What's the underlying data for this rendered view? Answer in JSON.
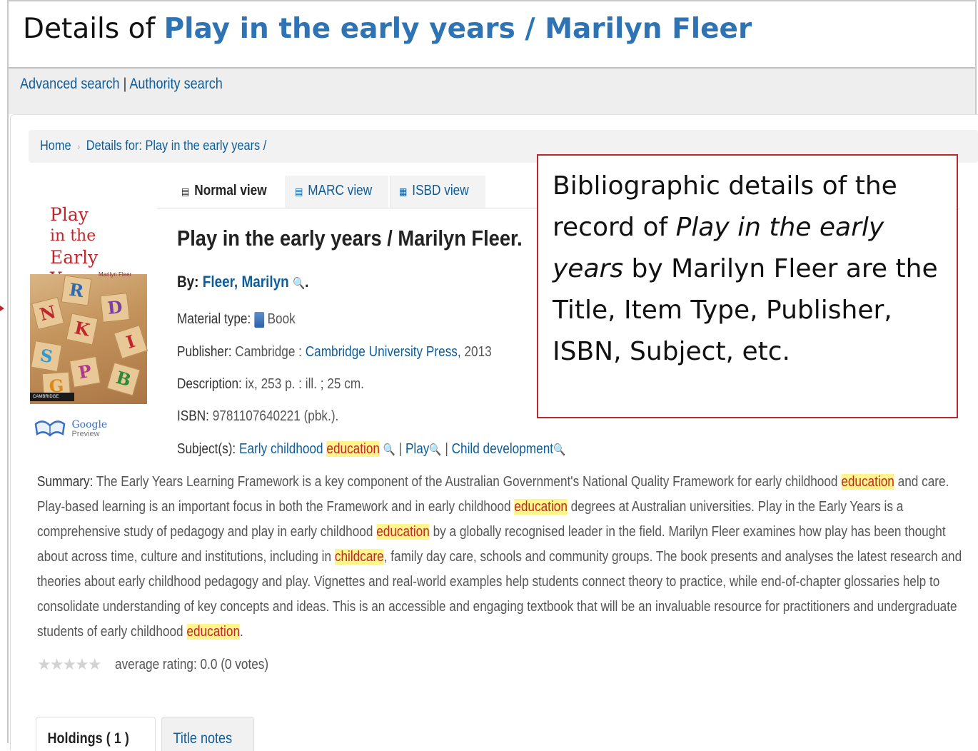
{
  "slide_title": {
    "prefix": "Details of ",
    "highlight": "Play in the early years / Marilyn Fleer"
  },
  "nav": {
    "advanced_search": "Advanced search",
    "separator": "|",
    "authority_search": "Authority search"
  },
  "breadcrumb": {
    "home": "Home",
    "current": "Details for: Play in the early years /"
  },
  "view_tabs": [
    {
      "label": "Normal view",
      "active": true
    },
    {
      "label": "MARC view",
      "active": false
    },
    {
      "label": "ISBD view",
      "active": false
    }
  ],
  "cover": {
    "title_line1": "Play",
    "title_line2": "in the",
    "title_line3": "Early Years",
    "author": "Marilyn Fleer",
    "publisher_band": "CAMBRIDGE",
    "blocks": [
      "N",
      "R",
      "D",
      "K",
      "I",
      "S",
      "P",
      "B",
      "G"
    ]
  },
  "google_preview": {
    "line1": "Google",
    "line2": "Preview"
  },
  "record": {
    "title": "Play in the early years / Marilyn Fleer.",
    "by_label": "By:",
    "author": "Fleer, Marilyn",
    "by_suffix": ".",
    "material_label": "Material type:",
    "material_value": "Book",
    "publisher_label": "Publisher:",
    "publisher_place": "Cambridge :",
    "publisher_name": "Cambridge University Press,",
    "publisher_year": "2013",
    "description_label": "Description:",
    "description_value": "ix, 253 p. : ill. ; 25 cm.",
    "isbn_label": "ISBN:",
    "isbn_value": "9781107640221 (pbk.).",
    "subjects_label": "Subject(s):",
    "subject1_a": "Early childhood",
    "subject1_b": "education",
    "subject_sep": "|",
    "subject2": "Play",
    "subject3": "Child development"
  },
  "summary": {
    "label": "Summary:",
    "p1": " The Early Years Learning Framework is a key component of the Australian Government's National Quality Framework for early childhood ",
    "hl1": "education",
    "p2": " and care. Play-based learning is an important focus in both the Framework and in early childhood ",
    "hl2": "education",
    "p3": " degrees at Australian universities. Play in the Early Years is a comprehensive study of pedagogy and play in early childhood ",
    "hl3": "education",
    "p4": " by a globally recognised leader in the field. Marilyn Fleer examines how play has been thought about across time, culture and institutions, including in ",
    "hl4": "childcare",
    "p5": ", family day care, schools and community groups. The book presents and analyses the latest research and theories about early childhood pedagogy and play. Vignettes and real-world examples help students connect theory to practice, while end-of-chapter glossaries help to consolidate understanding of key concepts and ideas. This is an accessible and engaging textbook that will be an invaluable resource for practitioners and undergraduate students of early childhood ",
    "hl5": "education",
    "p6": "."
  },
  "rating": {
    "stars": "★★★★★",
    "text": "average rating: 0.0 (0 votes)"
  },
  "bottom_tabs": [
    {
      "label": "Holdings ( 1 )",
      "active": true
    },
    {
      "label": "Title notes",
      "active": false
    }
  ],
  "annotation": {
    "t1": "Bibliographic details of the record of ",
    "t_italic": "Play in the early years",
    "t2": " by Marilyn Fleer are the Title, Item Type, Publisher, ISBN, Subject, etc."
  },
  "colors": {
    "link": "#0e5d9b",
    "title_accent": "#2e74b5",
    "annotation_border": "#c0272d",
    "highlight_bg": "#fff58a",
    "highlight_text": "#c0272d"
  }
}
